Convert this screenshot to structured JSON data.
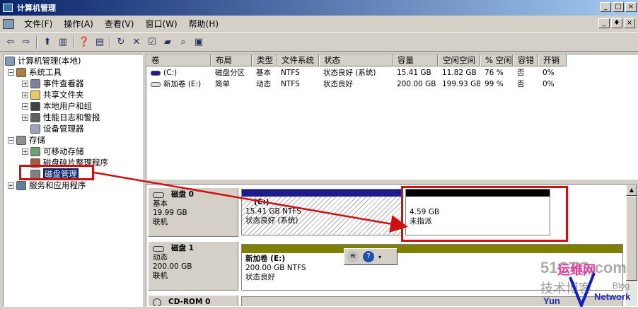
{
  "window": {
    "title": "计算机管理",
    "controls": [
      "_",
      "□",
      "×"
    ]
  },
  "menu": {
    "items": [
      "文件(F)",
      "操作(A)",
      "查看(V)",
      "窗口(W)",
      "帮助(H)"
    ],
    "mdi_controls": [
      "_",
      "♦",
      "×"
    ]
  },
  "toolbar": {
    "icons": [
      "back-arrow-icon",
      "forward-arrow-icon",
      "up-folder-icon",
      "show-tree-icon",
      "help-icon",
      "action-pane-icon",
      "refresh-icon",
      "delete-icon",
      "properties-icon",
      "open-icon",
      "search-icon",
      "drive-icon"
    ]
  },
  "tree": {
    "root": "计算机管理(本地)",
    "system_tools": "系统工具",
    "event_viewer": "事件查看器",
    "shared_folders": "共享文件夹",
    "local_users": "本地用户和组",
    "perf_logs": "性能日志和警报",
    "device_manager": "设备管理器",
    "storage": "存储",
    "removable_storage": "可移动存储",
    "defrag": "磁盘碎片整理程序",
    "disk_mgmt": "磁盘管理",
    "services_apps": "服务和应用程序"
  },
  "volumes": {
    "columns": [
      "卷",
      "布局",
      "类型",
      "文件系统",
      "状态",
      "容量",
      "空闲空间",
      "% 空闲",
      "容错",
      "开销"
    ],
    "rows": [
      [
        "(C:)",
        "磁盘分区",
        "基本",
        "NTFS",
        "状态良好 (系统)",
        "15.41 GB",
        "11.82 GB",
        "76 %",
        "否",
        "0%"
      ],
      [
        "新加卷 (E:)",
        "简单",
        "动态",
        "NTFS",
        "状态良好",
        "200.00 GB",
        "199.93 GB",
        "99 %",
        "否",
        "0%"
      ]
    ]
  },
  "disks": {
    "disk0": {
      "name": "磁盘 0",
      "type": "基本",
      "size": "19.99 GB",
      "status": "联机",
      "c_title": "(C:)",
      "c_size": "15.41 GB NTFS",
      "c_status": "状态良好 (系统)",
      "unalloc_size": "4.59 GB",
      "unalloc_label": "未指派"
    },
    "disk1": {
      "name": "磁盘 1",
      "type": "动态",
      "size": "200.00 GB",
      "status": "联机",
      "e_title": "新加卷  (E:)",
      "e_size": "200.00 GB NTFS",
      "e_status": "状态良好"
    },
    "cdrom": {
      "name": "CD-ROM 0"
    }
  },
  "watermark": {
    "line1": "51CTO.com",
    "line2": "技术博客",
    "line3": "Blog",
    "brand": "运维网",
    "brand2": "Yun",
    "brand3": "Network"
  },
  "colors": {
    "primary_partition": "#1c1c8c",
    "unallocated": "#000000",
    "simple_volume": "#7f7f00",
    "annotation": "#d01010"
  }
}
